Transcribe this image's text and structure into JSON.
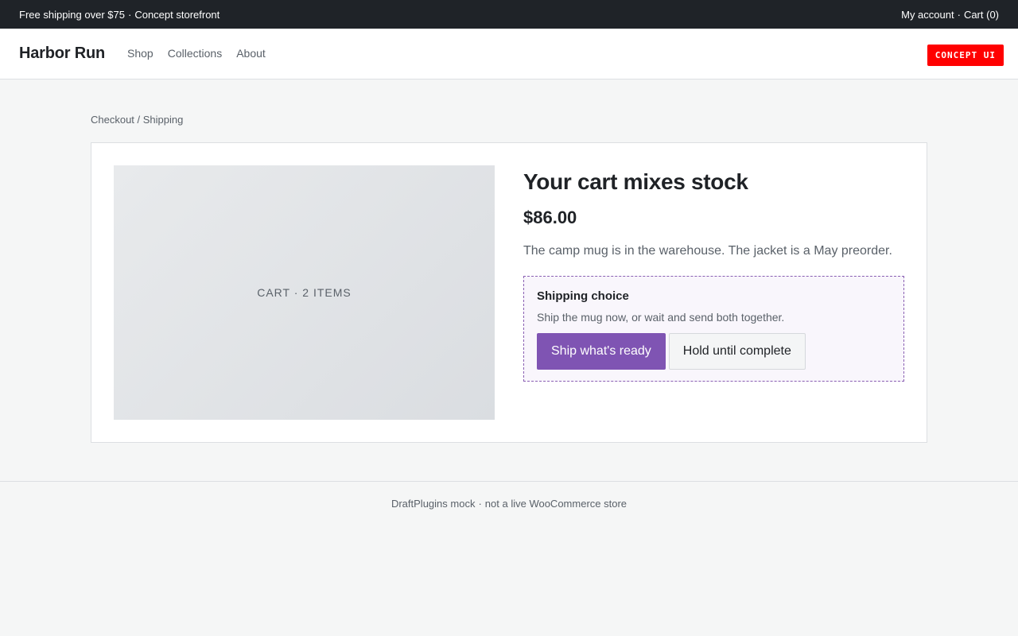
{
  "topbar": {
    "promo": "Free shipping over $75",
    "promo_suffix": "Concept storefront",
    "separator": "·",
    "account_link": "My account",
    "cart_link": "Cart (0)"
  },
  "header": {
    "brand": "Harbor Run",
    "nav": [
      "Shop",
      "Collections",
      "About"
    ],
    "badge": "CONCEPT UI"
  },
  "breadcrumb": "Checkout / Shipping",
  "product": {
    "image_label": "CART · 2 ITEMS",
    "title": "Your cart mixes stock",
    "price": "$86.00",
    "description": "The camp mug is in the warehouse. The jacket is a May preorder."
  },
  "shipping_choice": {
    "title": "Shipping choice",
    "description": "Ship the mug now, or wait and send both together.",
    "primary_button": "Ship what's ready",
    "secondary_button": "Hold until complete"
  },
  "footer": {
    "left": "DraftPlugins mock",
    "right": "not a live WooCommerce store",
    "separator": "·"
  },
  "colors": {
    "accent": "#7f54b3",
    "topbar_bg": "#1f2328",
    "badge_bg": "#ff0000"
  }
}
